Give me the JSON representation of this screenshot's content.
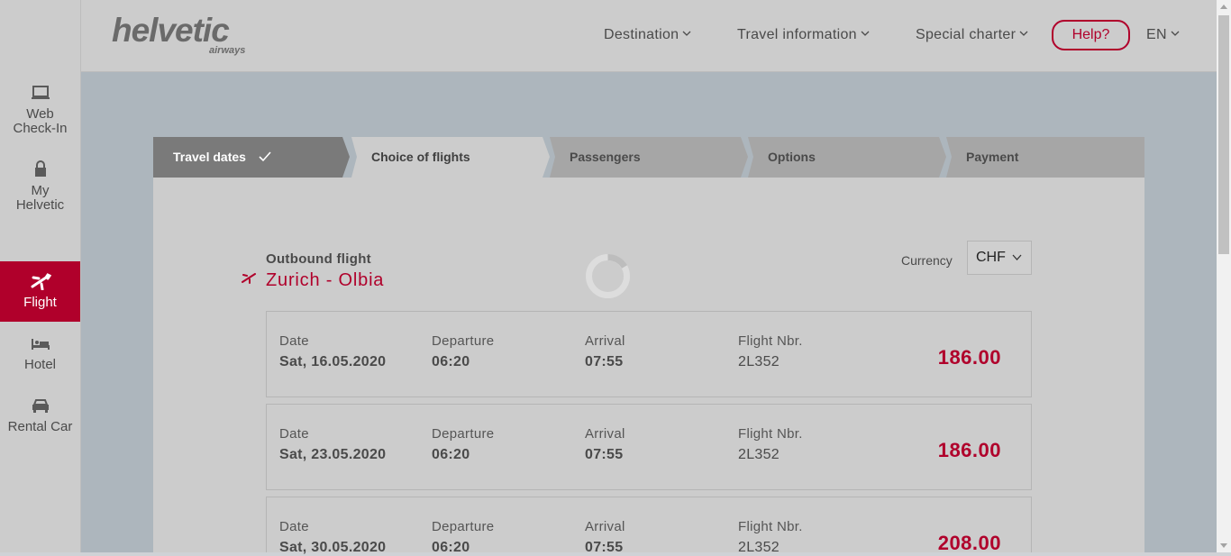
{
  "sidebar": {
    "items": [
      {
        "label_line1": "Web",
        "label_line2": "Check-In",
        "icon": "laptop-icon"
      },
      {
        "label_line1": "My",
        "label_line2": "Helvetic",
        "icon": "lock-icon"
      },
      {
        "label": "Flight",
        "icon": "plane-icon",
        "active": true
      },
      {
        "label": "Hotel",
        "icon": "bed-icon"
      },
      {
        "label": "Rental Car",
        "icon": "car-icon"
      }
    ]
  },
  "header": {
    "logo_main": "helvetic",
    "logo_sub": "airways",
    "nav": [
      {
        "label": "Destination"
      },
      {
        "label": "Travel information"
      },
      {
        "label": "Special charter"
      }
    ],
    "help_label": "Help?",
    "language": "EN"
  },
  "steps": [
    {
      "label": "Travel dates",
      "state": "done"
    },
    {
      "label": "Choice of flights",
      "state": "current"
    },
    {
      "label": "Passengers",
      "state": "upcoming"
    },
    {
      "label": "Options",
      "state": "upcoming"
    },
    {
      "label": "Payment",
      "state": "upcoming"
    }
  ],
  "outbound": {
    "label": "Outbound flight",
    "route": "Zurich - Olbia"
  },
  "currency": {
    "label": "Currency",
    "value": "CHF"
  },
  "flight_columns": {
    "date": "Date",
    "departure": "Departure",
    "arrival": "Arrival",
    "flight_nbr": "Flight Nbr."
  },
  "flights": [
    {
      "date": "Sat, 16.05.2020",
      "departure": "06:20",
      "arrival": "07:55",
      "flight_nbr": "2L352",
      "price": "186.00"
    },
    {
      "date": "Sat, 23.05.2020",
      "departure": "06:20",
      "arrival": "07:55",
      "flight_nbr": "2L352",
      "price": "186.00"
    },
    {
      "date": "Sat, 30.05.2020",
      "departure": "06:20",
      "arrival": "07:55",
      "flight_nbr": "2L352",
      "price": "208.00"
    }
  ],
  "colors": {
    "brand": "#b0002b",
    "sidebar": "#cccccc",
    "main_bg": "#adb6bd",
    "step_done": "#7a7a7a",
    "step_current": "#cccccc",
    "step_upcoming": "#a6a6a6"
  }
}
